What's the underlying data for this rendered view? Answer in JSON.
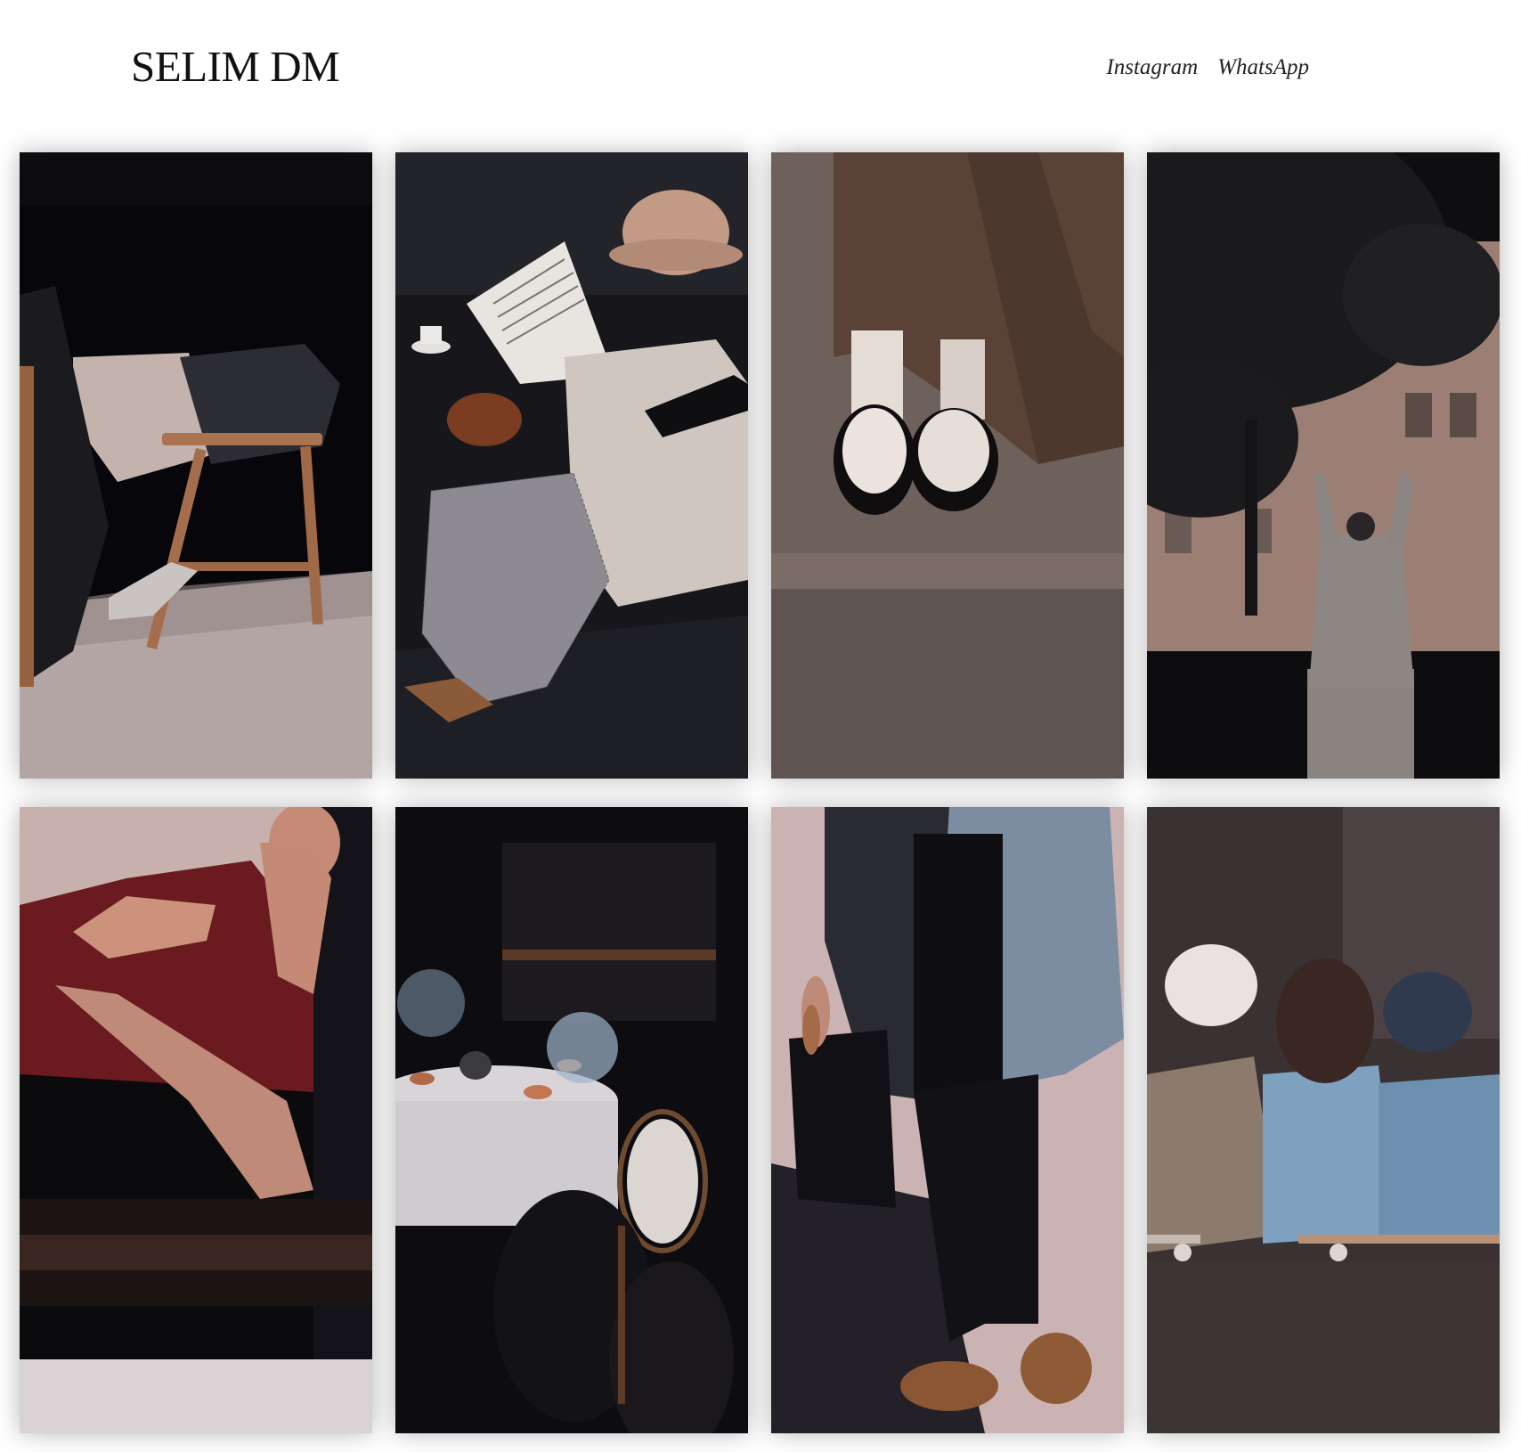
{
  "site": {
    "title": "SELIM DM"
  },
  "nav": {
    "links": [
      {
        "label": "Instagram",
        "icon": "instagram-link"
      },
      {
        "label": "WhatsApp",
        "icon": "whatsapp-link"
      }
    ]
  },
  "gallery": {
    "photos": [
      {
        "subject": "person seated on wooden stool in shadow",
        "palette": [
          "#07060a",
          "#b5a7a6",
          "#a06c4c"
        ]
      },
      {
        "subject": "woman in straw hat reading a book at cafe table",
        "palette": [
          "#161619",
          "#d3cbc4",
          "#b98c7a"
        ]
      },
      {
        "subject": "feet in white shoes under brown skirt on pavement",
        "palette": [
          "#6e5e58",
          "#5b4336",
          "#eae2dc"
        ]
      },
      {
        "subject": "person raising arms under tree in front of building",
        "palette": [
          "#0c0b0e",
          "#a7897d",
          "#8c8380"
        ]
      },
      {
        "subject": "woman in red top leaning on table",
        "palette": [
          "#0b0a0d",
          "#6d1a1f",
          "#c08a78"
        ]
      },
      {
        "subject": "cafe table with teacups and chairs in dark interior",
        "palette": [
          "#0d0c10",
          "#d7d3d6",
          "#8c5a3a"
        ]
      },
      {
        "subject": "man in blue jacket carrying bag walking",
        "palette": [
          "#cdb5b5",
          "#121217",
          "#7c8ea5"
        ]
      },
      {
        "subject": "three children sitting on skateboards",
        "palette": [
          "#3a3232",
          "#7ea0bf",
          "#8c7a6c"
        ]
      }
    ]
  }
}
